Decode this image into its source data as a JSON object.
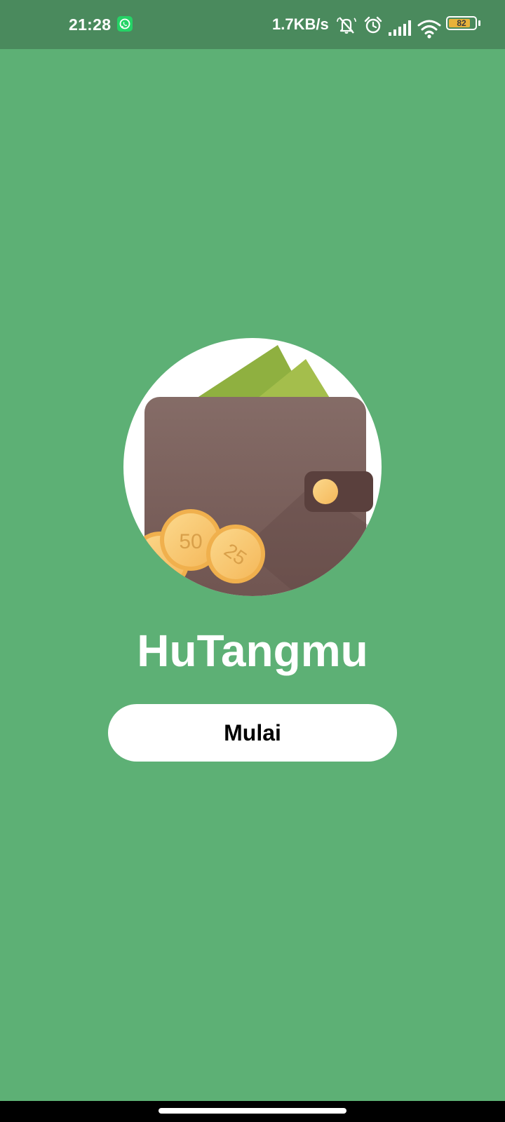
{
  "status_bar": {
    "time": "21:28",
    "network_speed": "1.7KB/s",
    "battery_level": "82",
    "battery_fraction": 0.82,
    "icons": [
      "whatsapp-icon",
      "bell-off-icon",
      "alarm-icon",
      "signal-icon",
      "wifi-icon",
      "battery-icon"
    ]
  },
  "logo": {
    "coins": [
      "50",
      "25"
    ]
  },
  "app": {
    "title": "HuTangmu"
  },
  "buttons": {
    "start_label": "Mulai"
  },
  "colors": {
    "background": "#5db075",
    "status_bar": "#4a8a5d",
    "wallet": "#7d5f59",
    "bill": "#9cba48",
    "coin": "#f9c66b",
    "battery_fill": "#e8b23a"
  }
}
